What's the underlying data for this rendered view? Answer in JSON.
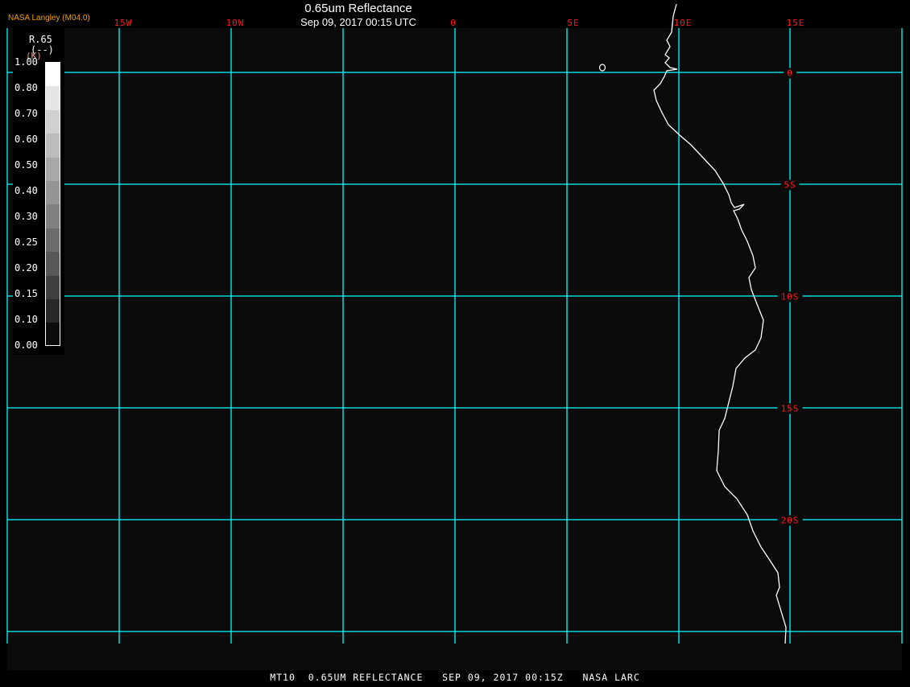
{
  "header": {
    "title": "0.65um Reflectance",
    "subtitle": "Sep 09, 2017 00:15 UTC",
    "brand": "NASA Langley (M04.0)"
  },
  "map": {
    "lon_labels": [
      "15W",
      "10W",
      "0",
      "5E",
      "10E",
      "15E"
    ],
    "lat_labels": [
      "0",
      "5S",
      "10S",
      "15S",
      "20S"
    ],
    "grid_color": "#00ffff",
    "label_color": "#ff0000",
    "coastline_color": "#ffffff",
    "background": "#0b0b0b"
  },
  "legend": {
    "variable": "R.65",
    "units": "(--)",
    "units_overlay": "(K)",
    "labels": [
      "1.00",
      "0.80",
      "0.70",
      "0.60",
      "0.50",
      "0.40",
      "0.30",
      "0.25",
      "0.20",
      "0.15",
      "0.10",
      "0.00"
    ],
    "colors": [
      "#ffffff",
      "#e6e6e6",
      "#d0d0d0",
      "#bcbcbc",
      "#a8a8a8",
      "#949494",
      "#808080",
      "#6c6c6c",
      "#585858",
      "#3f3f3f",
      "#282828",
      "#0b0b0b"
    ]
  },
  "footer": {
    "text": "MT10  0.65UM REFLECTANCE   SEP 09, 2017 00:15Z   NASA LARC"
  }
}
